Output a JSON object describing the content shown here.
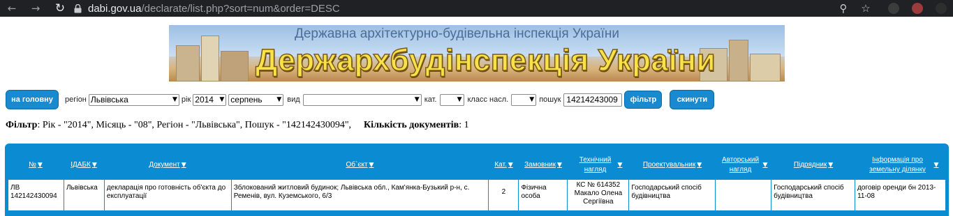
{
  "browser": {
    "url_host": "dabi.gov.ua",
    "url_path": "/declarate/list.php?sort=num&order=DESC"
  },
  "banner": {
    "subtitle": "Державна архітектурно-будівельна інспекція України",
    "title": "Держархбудінспекція України"
  },
  "filters": {
    "home_button": "на головну",
    "region_label": "регіон",
    "region_value": "Львівська",
    "year_label": "рік",
    "year_value": "2014",
    "month_value": "серпень",
    "type_label": "вид",
    "type_value": "",
    "category_label": "кат.",
    "category_value": "",
    "class_label": "класс насл.",
    "class_value": "",
    "search_label": "пошук",
    "search_value": "14214243009",
    "filter_button": "фільтр",
    "reset_button": "скинути"
  },
  "summary": {
    "filter_label": "Фільтр",
    "filter_text": ": Рік - \"2014\", Місяць - \"08\", Регіон - \"Львівська\", Пошук - \"142142430094\",",
    "count_label": "Кількість документів",
    "count_value": ": 1"
  },
  "table": {
    "headers": [
      "№",
      "ІДАБК",
      "Документ",
      "Об`єкт",
      "Кат.",
      "Замовник",
      "Технічний нагляд",
      "Проектувальник",
      "Авторський нагляд",
      "Підрядник",
      "Інформація про земельну ділянку"
    ],
    "rows": [
      [
        "ЛВ 142142430094",
        "Львівська",
        "декларація про готовність об'єкта до експлуатації",
        "Зблокований житловий будинок; Львівська обл., Кам'янка-Бузький р-н, с. Ременів, вул. Куземського, 6/3",
        "2",
        "Фізична особа",
        "КС № 614352 Макало Олена Сергіївна",
        "Господарський спосіб будівництва",
        "",
        "Господарський спосіб будівництва",
        "договір оренди бн 2013-11-08"
      ]
    ]
  },
  "colors": {
    "accent": "#0b8bd2",
    "button": "#1a8ad0",
    "chrome": "#202124"
  }
}
